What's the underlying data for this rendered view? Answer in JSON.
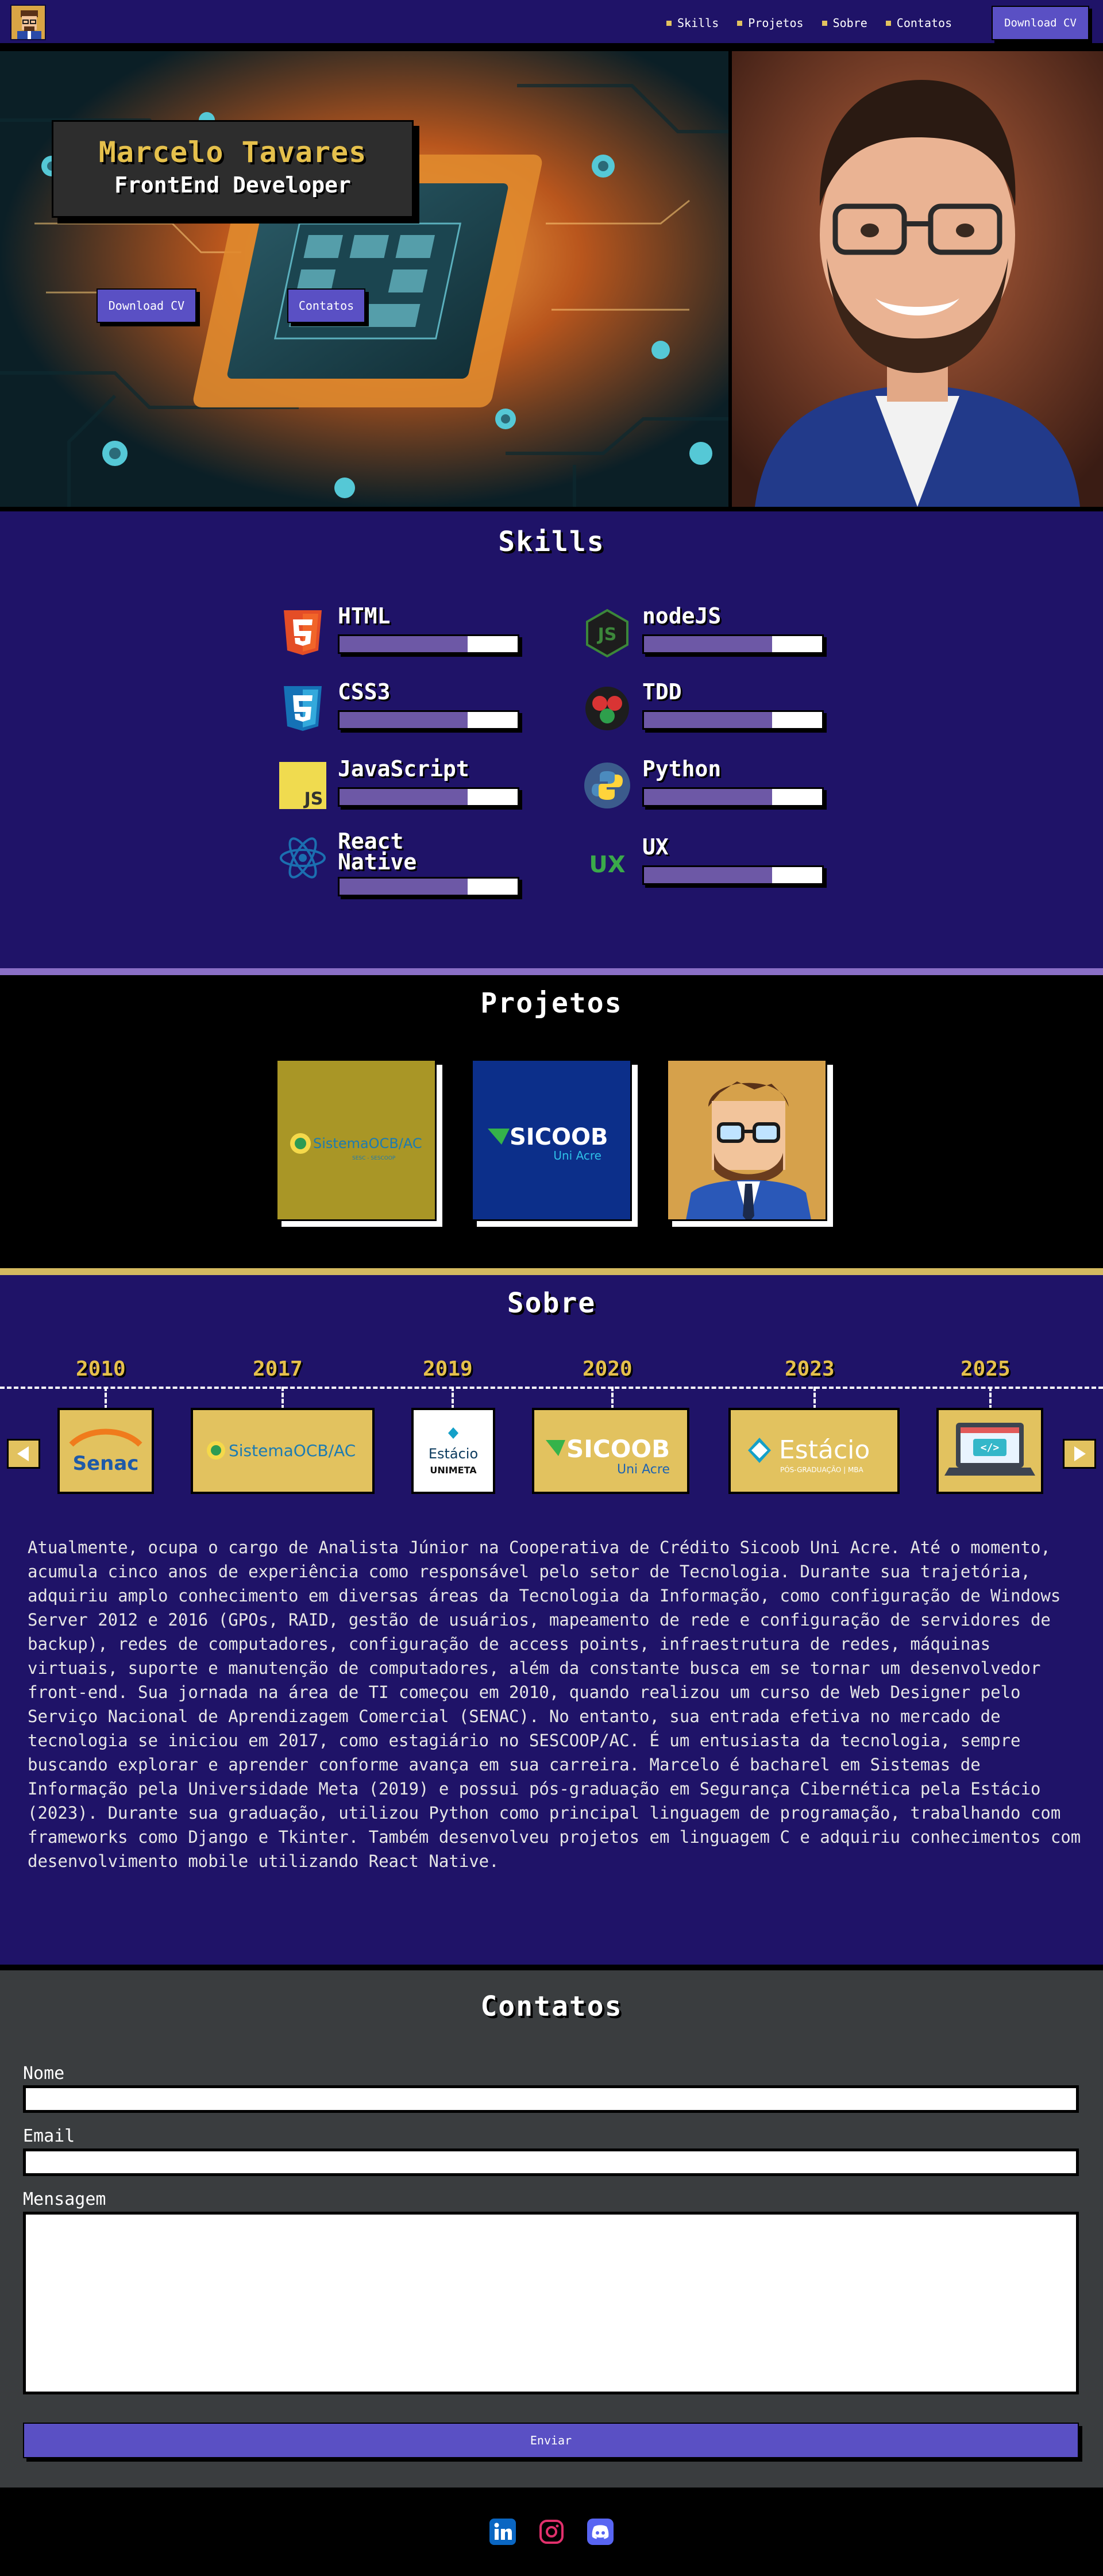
{
  "nav": {
    "links": [
      {
        "label": "Skills"
      },
      {
        "label": "Projetos"
      },
      {
        "label": "Sobre"
      },
      {
        "label": "Contatos"
      }
    ],
    "download_label": "Download CV"
  },
  "hero": {
    "name": "Marcelo Tavares",
    "role": "FrontEnd Developer",
    "download_label": "Download CV",
    "contacts_label": "Contatos"
  },
  "skills": {
    "title": "Skills",
    "items": [
      {
        "name": "HTML",
        "level": 0.72,
        "icon": "html5-icon"
      },
      {
        "name": "CSS3",
        "level": 0.72,
        "icon": "css3-icon"
      },
      {
        "name": "JavaScript",
        "level": 0.72,
        "icon": "javascript-icon"
      },
      {
        "name": "React Native",
        "level": 0.72,
        "icon": "react-icon"
      },
      {
        "name": "nodeJS",
        "level": 0.72,
        "icon": "nodejs-icon"
      },
      {
        "name": "TDD",
        "level": 0.72,
        "icon": "tdd-icon"
      },
      {
        "name": "Python",
        "level": 0.72,
        "icon": "python-icon"
      },
      {
        "name": "UX",
        "level": 0.72,
        "icon": "ux-icon"
      }
    ]
  },
  "projects": {
    "title": "Projetos",
    "items": [
      {
        "logo_text": "SistemaOCB/AC",
        "logo_sub": "SESC - SESCOOP"
      },
      {
        "logo_text": "SICOOB",
        "logo_sub": "Uni Acre"
      },
      {
        "logo_text": ""
      }
    ]
  },
  "about": {
    "title": "Sobre",
    "timeline": [
      {
        "year": "2010",
        "logo": "Senac"
      },
      {
        "year": "2017",
        "logo": "SistemaOCB/AC"
      },
      {
        "year": "2019",
        "logo": "Estácio",
        "logo_sub": "UNIMETA"
      },
      {
        "year": "2020",
        "logo": "SICOOB",
        "logo_sub": "Uni Acre"
      },
      {
        "year": "2023",
        "logo": "Estácio",
        "logo_sub": "PÓS-GRADUAÇÃO | MBA"
      },
      {
        "year": "2025",
        "logo": ""
      }
    ],
    "text": "Atualmente, ocupa o cargo de Analista Júnior na Cooperativa de Crédito Sicoob Uni Acre. Até o momento, acumula cinco anos de experiência como responsável pelo setor de Tecnologia. Durante sua trajetória, adquiriu amplo conhecimento em diversas áreas da Tecnologia da Informação, como configuração de Windows Server 2012 e 2016 (GPOs, RAID, gestão de usuários, mapeamento de rede e configuração de servidores de backup), redes de computadores, configuração de access points, infraestrutura de redes, máquinas virtuais, suporte e manutenção de computadores, além da constante busca em se tornar um desenvolvedor front-end. Sua jornada na área de TI começou em 2010, quando realizou um curso de Web Designer pelo Serviço Nacional de Aprendizagem Comercial (SENAC). No entanto, sua entrada efetiva no mercado de tecnologia se iniciou em 2017, como estagiário no SESCOOP/AC. É um entusiasta da tecnologia, sempre buscando explorar e aprender conforme avança em sua carreira. Marcelo é bacharel em Sistemas de Informação pela Universidade Meta (2019) e possui pós-graduação em Segurança Cibernética pela Estácio (2023). Durante sua graduação, utilizou Python como principal linguagem de programação, trabalhando com frameworks como Django e Tkinter. Também desenvolveu projetos em linguagem C e adquiriu conhecimentos com desenvolvimento mobile utilizando React Native."
  },
  "contacts": {
    "title": "Contatos",
    "name_label": "Nome",
    "email_label": "Email",
    "message_label": "Mensagem",
    "send_label": "Enviar"
  },
  "footer": {
    "socials": [
      "linkedin-icon",
      "instagram-icon",
      "discord-icon"
    ]
  },
  "colors": {
    "navy": "#1f1368",
    "gold": "#e2c25f",
    "button": "#5a50c4",
    "bar_fill": "#6d58a6"
  }
}
